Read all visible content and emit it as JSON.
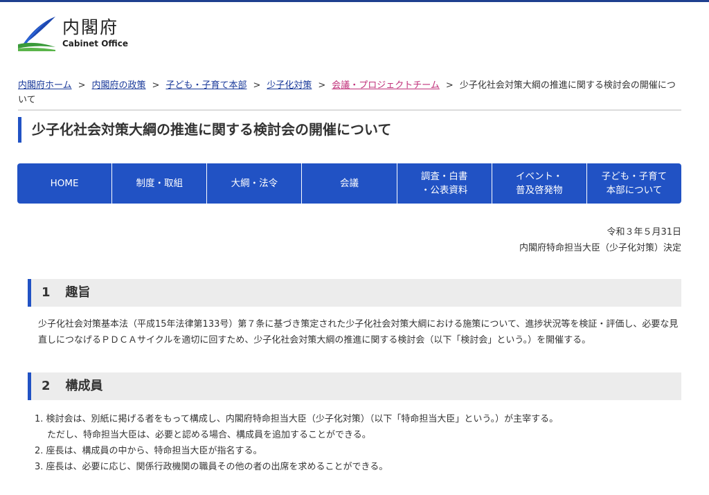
{
  "header": {
    "logo_ja": "内閣府",
    "logo_en": "Cabinet Office",
    "brand_color": "#2152c4"
  },
  "breadcrumb": {
    "items": [
      {
        "label": "内閣府ホーム"
      },
      {
        "label": "内閣府の政策"
      },
      {
        "label": "子ども・子育て本部"
      },
      {
        "label": "少子化対策"
      },
      {
        "label": "会議・プロジェクトチーム",
        "color": "#c0307a"
      }
    ],
    "separator": ">",
    "current": "少子化社会対策大綱の推進に関する検討会の開催について"
  },
  "page": {
    "title": "少子化社会対策大綱の推進に関する検討会の開催について"
  },
  "nav": {
    "items": [
      {
        "label": "HOME"
      },
      {
        "label": "制度・取組"
      },
      {
        "label": "大綱・法令"
      },
      {
        "label": "会議"
      },
      {
        "label": "調査・白書\n・公表資料"
      },
      {
        "label": "イベント・\n普及啓発物"
      },
      {
        "label": "子ども・子育て\n本部について"
      }
    ]
  },
  "meta": {
    "date": "令和３年５月31日",
    "author": "内閣府特命担当大臣（少子化対策）決定"
  },
  "sections": [
    {
      "num": "1",
      "title": "趣旨",
      "text": "少子化社会対策基本法（平成15年法律第133号）第７条に基づき策定された少子化社会対策大綱における施策について、進捗状況等を検証・評価し、必要な見直しにつなげるＰＤＣＡサイクルを適切に回すため、少子化社会対策大綱の推進に関する検討会（以下「検討会」という。）を開催する。"
    },
    {
      "num": "2",
      "title": "構成員",
      "items": [
        "1. 検討会は、別紙に掲げる者をもって構成し、内閣府特命担当大臣（少子化対策）（以下「特命担当大臣」という。）が主宰する。",
        "ただし、特命担当大臣は、必要と認める場合、構成員を追加することができる。",
        "2. 座長は、構成員の中から、特命担当大臣が指名する。",
        "3. 座長は、必要に応じ、関係行政機関の職員その他の者の出席を求めることができる。"
      ]
    }
  ]
}
